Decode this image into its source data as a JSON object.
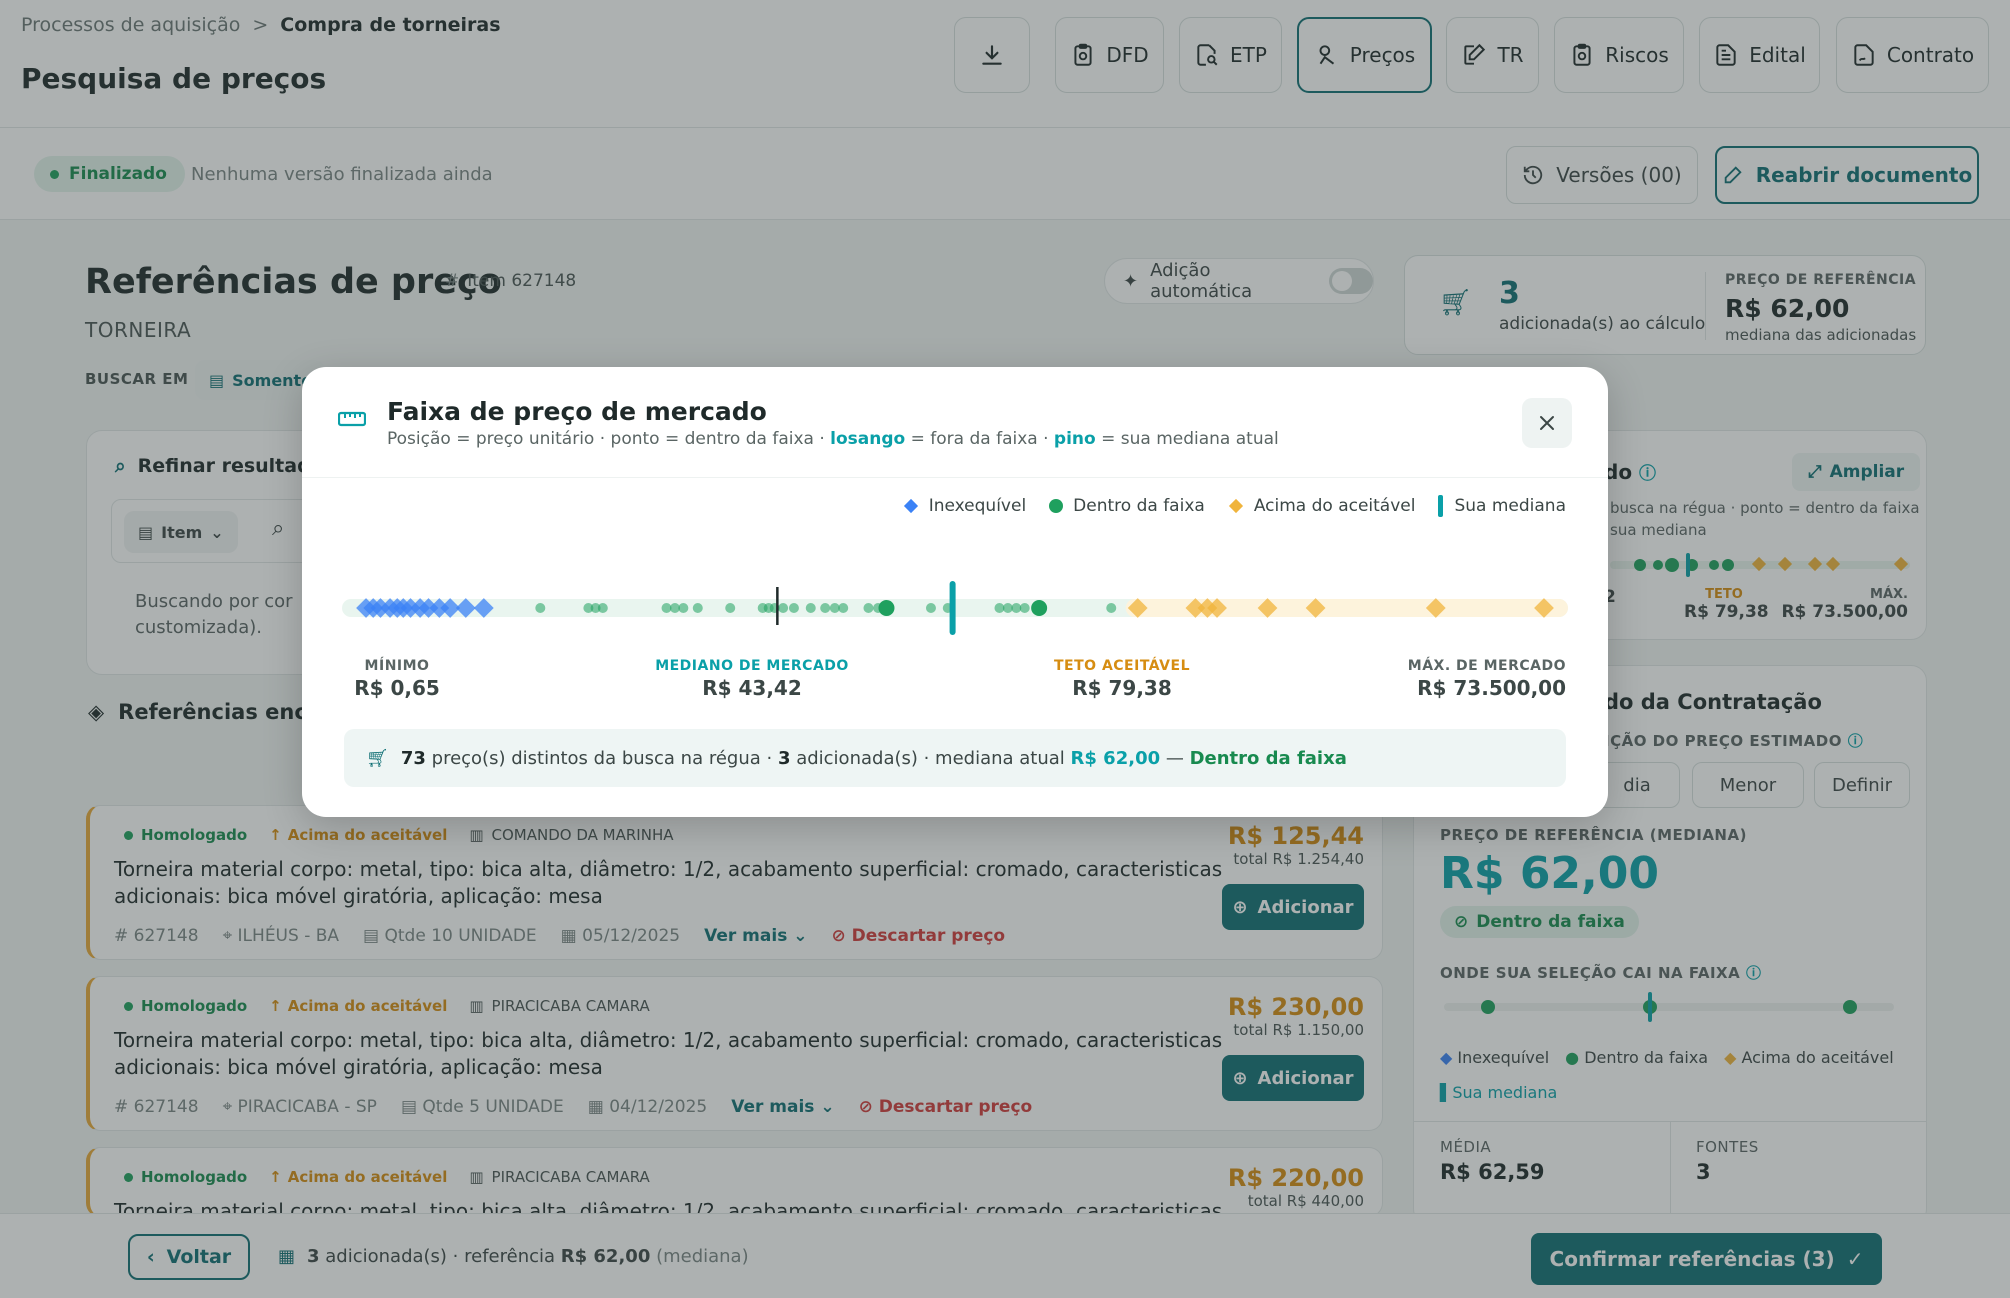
{
  "breadcrumb": {
    "parent": "Processos de aquisição",
    "separator": ">",
    "current": "Compra de torneiras"
  },
  "page_title": "Pesquisa de preços",
  "toolbar": {
    "tabs": [
      {
        "id": "download",
        "label": ""
      },
      {
        "id": "dfd",
        "label": "DFD"
      },
      {
        "id": "etp",
        "label": "ETP"
      },
      {
        "id": "precos",
        "label": "Preços",
        "active": true
      },
      {
        "id": "tr",
        "label": "TR"
      },
      {
        "id": "riscos",
        "label": "Riscos"
      },
      {
        "id": "edital",
        "label": "Edital"
      },
      {
        "id": "contrato",
        "label": "Contrato"
      }
    ]
  },
  "status": {
    "badge": "Finalizado",
    "text": "Nenhuma versão finalizada ainda",
    "versions_label": "Versões (00)",
    "reopen_label": "Reabrir documento"
  },
  "references": {
    "title": "Referências de preço",
    "item_tag": "Item 627148",
    "item_name": "TORNEIRA",
    "search_in_label": "BUSCAR EM",
    "search_in_value": "Somente",
    "auto_add_label": "Adição automática",
    "refine_label": "Refinar resultados",
    "item_filter_label": "Item",
    "search_note": "Buscando por cor\ncustomizada).",
    "found_label": "Referências encon"
  },
  "summary": {
    "count": "3",
    "count_label": "adicionada(s) ao cálculo",
    "ref_label": "PREÇO DE REFERÊNCIA",
    "ref_value": "R$ 62,00",
    "ref_sub": "mediana das adicionadas"
  },
  "mini_ruler": {
    "title_fragment": "do",
    "expand_label": "Ampliar",
    "note": "busca na régua · ponto = dentro da faixa\nsua mediana",
    "labels": {
      "left": "2",
      "teto_label": "TETO",
      "teto_value": "R$ 79,38",
      "max_label": "MÁX.",
      "max_value": "R$ 73.500,00"
    }
  },
  "contracting": {
    "title": "do da Contratação",
    "definition_label": "IÇÃO DO PREÇO ESTIMADO",
    "options": [
      "dia",
      "Menor",
      "Definir"
    ],
    "ref_label": "PREÇO DE REFERÊNCIA (MEDIANA)",
    "ref_value": "R$ 62,00",
    "in_range_badge": "Dentro da faixa",
    "where_label": "ONDE SUA SELEÇÃO CAI NA FAIXA",
    "legend": [
      "Inexequível",
      "Dentro da faixa",
      "Acima do aceitável",
      "Sua mediana"
    ],
    "media_label": "MÉDIA",
    "media_value": "R$ 62,59",
    "fontes_label": "FONTES",
    "fontes_value": "3"
  },
  "results": [
    {
      "status": "Homologado",
      "flag": "Acima do aceitável",
      "org": "COMANDO DA MARINHA",
      "desc": "Torneira material corpo: metal, tipo: bica alta, diâmetro: 1/2, acabamento superficial: cromado, caracteristicas adicionais: bica móvel giratória, aplicação: mesa",
      "code": "627148",
      "place": "ILHÉUS - BA",
      "qty": "Qtde 10 UNIDADE",
      "date": "05/12/2025",
      "more": "Ver mais",
      "discard": "Descartar preço",
      "price": "R$ 125,44",
      "total": "total R$ 1.254,40",
      "add": "Adicionar"
    },
    {
      "status": "Homologado",
      "flag": "Acima do aceitável",
      "org": "PIRACICABA CAMARA",
      "desc": "Torneira material corpo: metal, tipo: bica alta, diâmetro: 1/2, acabamento superficial: cromado, caracteristicas adicionais: bica móvel giratória, aplicação: mesa",
      "code": "627148",
      "place": "PIRACICABA - SP",
      "qty": "Qtde 5 UNIDADE",
      "date": "04/12/2025",
      "more": "Ver mais",
      "discard": "Descartar preço",
      "price": "R$ 230,00",
      "total": "total R$ 1.150,00",
      "add": "Adicionar"
    },
    {
      "status": "Homologado",
      "flag": "Acima do aceitável",
      "org": "PIRACICABA CAMARA",
      "desc": "Torneira material corpo: metal, tipo: bica alta, diâmetro: 1/2, acabamento superficial: cromado, caracteristicas adicionais:",
      "price": "R$ 220,00",
      "total": "total R$ 440,00"
    }
  ],
  "footer": {
    "back_label": "Voltar",
    "summary_count": "3",
    "summary_mid": " adicionada(s) · referência ",
    "summary_value": "R$ 62,00",
    "summary_tail": " (mediana)",
    "confirm_label": "Confirmar referências (3)"
  },
  "modal": {
    "title": "Faixa de preço de mercado",
    "subtitle_a": "Posição = preço unitário · ponto = dentro da faixa · ",
    "subtitle_b": "losango",
    "subtitle_c": " = fora da faixa · ",
    "subtitle_d": "pino",
    "subtitle_e": " = sua mediana atual",
    "legend": [
      "Inexequível",
      "Dentro da faixa",
      "Acima do aceitável",
      "Sua mediana"
    ],
    "stats": {
      "min_label": "MÍNIMO",
      "min_value": "R$ 0,65",
      "median_label": "MEDIANO DE MERCADO",
      "median_value": "R$ 43,42",
      "teto_label": "TETO ACEITÁVEL",
      "teto_value": "R$ 79,38",
      "max_label": "MÁX. DE MERCADO",
      "max_value": "R$ 73.500,00"
    },
    "info": {
      "count": "73",
      "text1": " preço(s) distintos da busca na régua · ",
      "added": "3",
      "text2": " adicionada(s) · mediana atual ",
      "median": "R$ 62,00",
      "sep": " — ",
      "status": "Dentro da faixa"
    },
    "colors": {
      "inexequivel": "#3b82f6",
      "dentro": "#1fa05e",
      "acima": "#f0b43c",
      "mediana": "#0aa0a8"
    }
  },
  "chart_data": {
    "type": "scatter",
    "title": "Faixa de preço de mercado",
    "scale": "rank-ordered price ruler",
    "min": 0.65,
    "market_median": 43.42,
    "ceiling": 79.38,
    "max": 73500.0,
    "current_median": 62.0,
    "points": [
      {
        "pos": 0.01,
        "cls": "inexequivel"
      },
      {
        "pos": 0.016,
        "cls": "inexequivel"
      },
      {
        "pos": 0.022,
        "cls": "inexequivel"
      },
      {
        "pos": 0.03,
        "cls": "inexequivel"
      },
      {
        "pos": 0.036,
        "cls": "inexequivel"
      },
      {
        "pos": 0.041,
        "cls": "inexequivel"
      },
      {
        "pos": 0.047,
        "cls": "inexequivel"
      },
      {
        "pos": 0.055,
        "cls": "inexequivel"
      },
      {
        "pos": 0.062,
        "cls": "inexequivel"
      },
      {
        "pos": 0.071,
        "cls": "inexequivel"
      },
      {
        "pos": 0.08,
        "cls": "inexequivel"
      },
      {
        "pos": 0.093,
        "cls": "inexequivel"
      },
      {
        "pos": 0.108,
        "cls": "inexequivel"
      },
      {
        "pos": 0.155,
        "cls": "dentro"
      },
      {
        "pos": 0.195,
        "cls": "dentro"
      },
      {
        "pos": 0.201,
        "cls": "dentro"
      },
      {
        "pos": 0.207,
        "cls": "dentro"
      },
      {
        "pos": 0.26,
        "cls": "dentro"
      },
      {
        "pos": 0.267,
        "cls": "dentro"
      },
      {
        "pos": 0.274,
        "cls": "dentro"
      },
      {
        "pos": 0.286,
        "cls": "dentro"
      },
      {
        "pos": 0.313,
        "cls": "dentro"
      },
      {
        "pos": 0.34,
        "cls": "dentro"
      },
      {
        "pos": 0.345,
        "cls": "dentro"
      },
      {
        "pos": 0.35,
        "cls": "dentro"
      },
      {
        "pos": 0.357,
        "cls": "dentro"
      },
      {
        "pos": 0.366,
        "cls": "dentro"
      },
      {
        "pos": 0.38,
        "cls": "dentro"
      },
      {
        "pos": 0.392,
        "cls": "dentro"
      },
      {
        "pos": 0.4,
        "cls": "dentro"
      },
      {
        "pos": 0.407,
        "cls": "dentro"
      },
      {
        "pos": 0.428,
        "cls": "dentro"
      },
      {
        "pos": 0.436,
        "cls": "dentro"
      },
      {
        "pos": 0.443,
        "cls": "dentro",
        "selected": true
      },
      {
        "pos": 0.48,
        "cls": "dentro"
      },
      {
        "pos": 0.494,
        "cls": "dentro"
      },
      {
        "pos": 0.537,
        "cls": "dentro"
      },
      {
        "pos": 0.544,
        "cls": "dentro"
      },
      {
        "pos": 0.551,
        "cls": "dentro"
      },
      {
        "pos": 0.558,
        "cls": "dentro"
      },
      {
        "pos": 0.57,
        "cls": "dentro",
        "selected": true
      },
      {
        "pos": 0.63,
        "cls": "dentro"
      },
      {
        "pos": 0.652,
        "cls": "acima"
      },
      {
        "pos": 0.7,
        "cls": "acima"
      },
      {
        "pos": 0.71,
        "cls": "acima"
      },
      {
        "pos": 0.718,
        "cls": "acima"
      },
      {
        "pos": 0.76,
        "cls": "acima"
      },
      {
        "pos": 0.8,
        "cls": "acima"
      },
      {
        "pos": 0.9,
        "cls": "acima"
      },
      {
        "pos": 0.99,
        "cls": "acima"
      }
    ],
    "market_median_pos": 0.352,
    "current_median_pos": 0.498
  }
}
